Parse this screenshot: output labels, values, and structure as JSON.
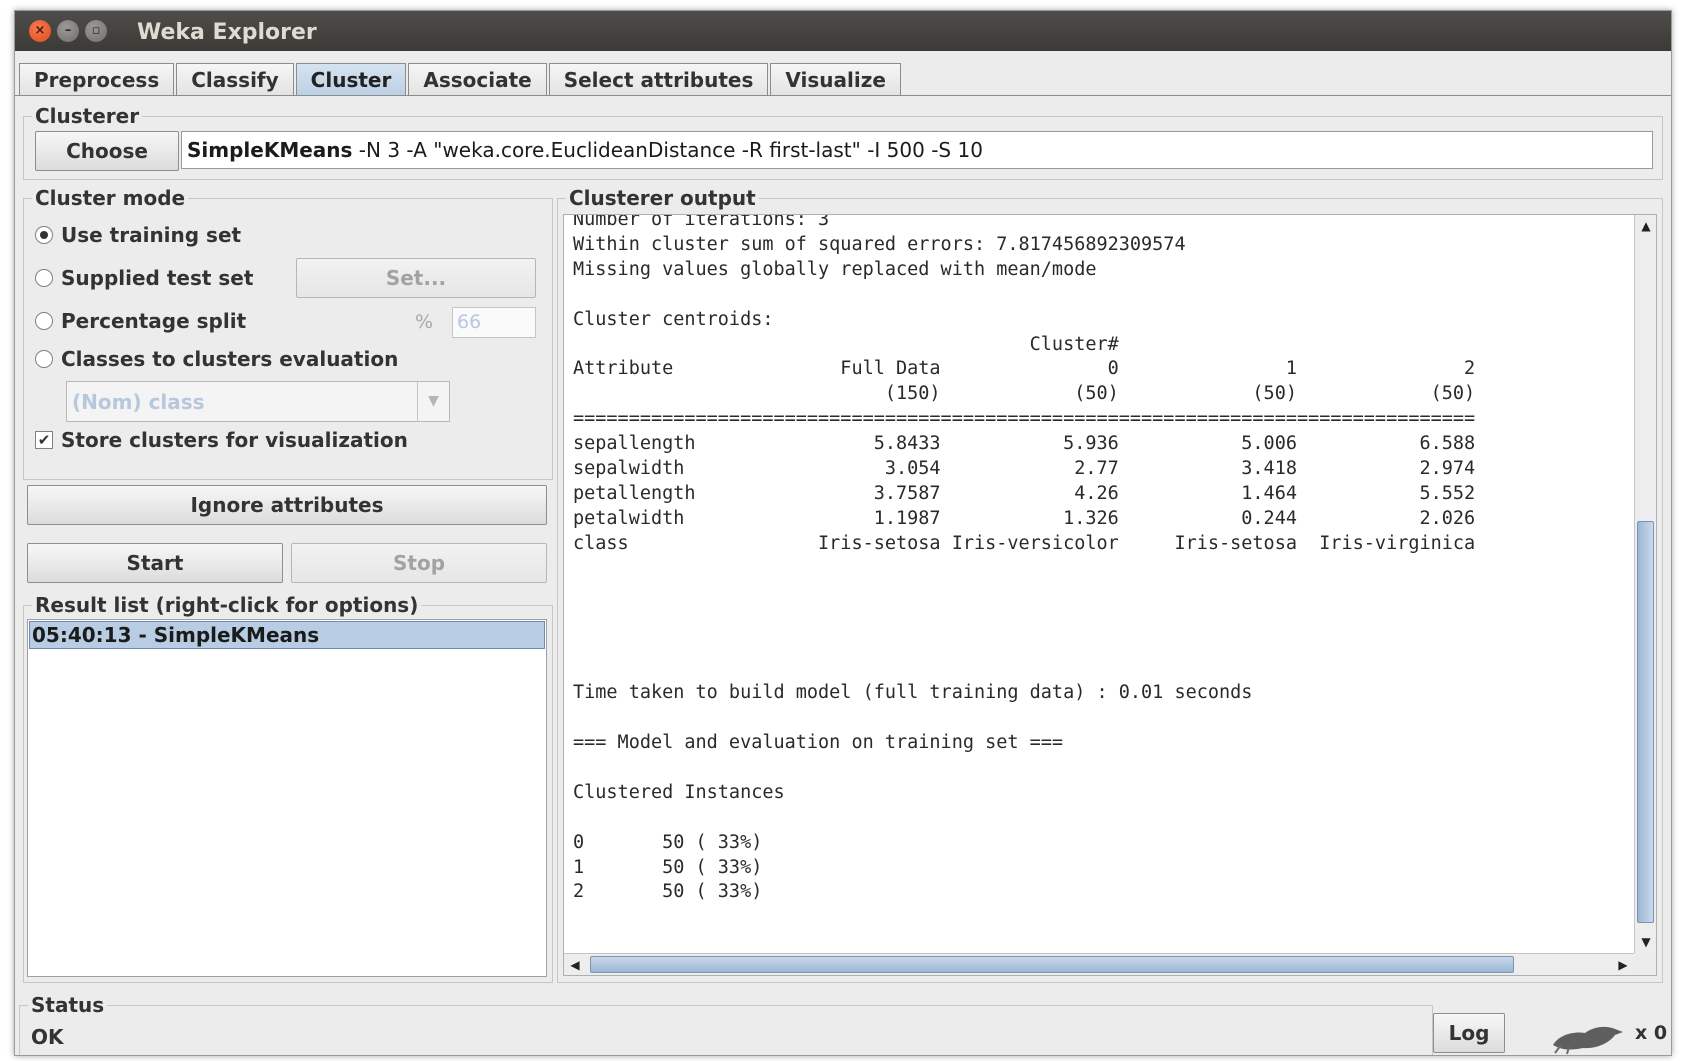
{
  "window": {
    "title": "Weka Explorer"
  },
  "tabs": [
    "Preprocess",
    "Classify",
    "Cluster",
    "Associate",
    "Select attributes",
    "Visualize"
  ],
  "clusterer": {
    "legend": "Clusterer",
    "choose_label": "Choose",
    "algorithm": "SimpleKMeans",
    "options": " -N 3 -A \"weka.core.EuclideanDistance -R first-last\" -I 500 -S 10"
  },
  "cluster_mode": {
    "legend": "Cluster mode",
    "use_training_set": "Use training set",
    "supplied_test_set": "Supplied test set",
    "set_button": "Set...",
    "percentage_split": "Percentage split",
    "percent_symbol": "%",
    "percent_value": "66",
    "classes_to_clusters": "Classes to clusters evaluation",
    "class_select": "(Nom) class",
    "store_clusters": "Store clusters for visualization",
    "store_clusters_check": "✔"
  },
  "actions": {
    "ignore_attributes": "Ignore attributes",
    "start": "Start",
    "stop": "Stop"
  },
  "result_list": {
    "legend": "Result list (right-click for options)",
    "items": [
      "05:40:13 - SimpleKMeans"
    ]
  },
  "output": {
    "legend": "Clusterer output",
    "text": "Number of iterations: 3\nWithin cluster sum of squared errors: 7.817456892309574\nMissing values globally replaced with mean/mode\n\nCluster centroids:\n                                         Cluster#\nAttribute               Full Data               0               1               2\n                            (150)            (50)            (50)            (50)\n=================================================================================\nsepallength                5.8433           5.936           5.006           6.588\nsepalwidth                  3.054            2.77           3.418           2.974\npetallength                3.7587            4.26           1.464           5.552\npetalwidth                 1.1987           1.326           0.244           2.026\nclass                 Iris-setosa Iris-versicolor     Iris-setosa  Iris-virginica\n\n\n\n\n\nTime taken to build model (full training data) : 0.01 seconds\n\n=== Model and evaluation on training set ===\n\nClustered Instances\n\n0       50 ( 33%)\n1       50 ( 33%)\n2       50 ( 33%)"
  },
  "status": {
    "legend": "Status",
    "text": "OK",
    "log_button": "Log",
    "count": "x 0"
  },
  "icons": {
    "close": "close-icon",
    "minimize": "minimize-icon",
    "maximize": "maximize-icon",
    "dropdown": "chevron-down-icon",
    "scroll_up": "arrow-up-icon",
    "scroll_down": "arrow-down-icon",
    "scroll_left": "arrow-left-icon",
    "scroll_right": "arrow-right-icon",
    "weka_bird": "weka-bird-icon"
  }
}
